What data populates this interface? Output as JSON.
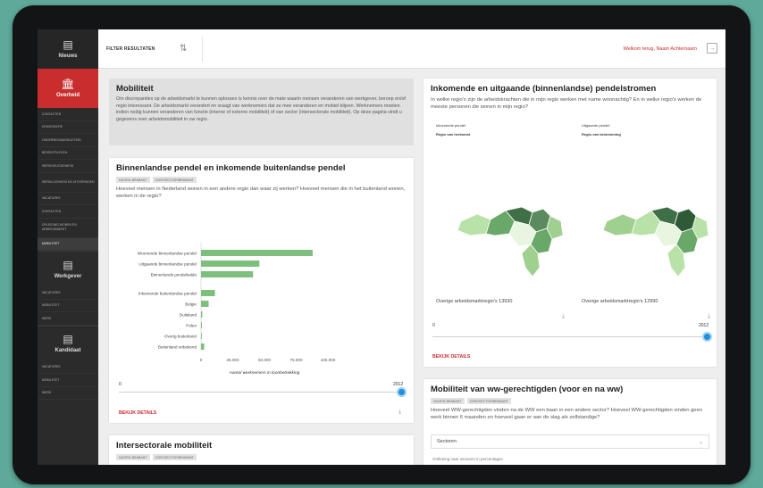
{
  "sidebar": {
    "nieuws": "Nieuws",
    "overheid": "Overheid",
    "overheid_items": [
      "Contacten",
      "Demografie",
      "Onderwijsaansluiting",
      "Bedrijfsleven",
      "Werkgelegenheid",
      "Werkloosheid en uitkeringen",
      "Vacatures",
      "Contacten",
      "Opleiding wonen en arbeidsmarkt",
      "Mobiliteit"
    ],
    "active_item_index": 9,
    "werkgever": "Werkgever",
    "werkgever_items": [
      "Vacatures",
      "Mobiliteit",
      "Werk"
    ],
    "kandidaat": "Kandidaat",
    "kandidaat_items": [
      "Vacatures",
      "Mobiliteit",
      "Werk"
    ]
  },
  "topbar": {
    "filter_label": "FILTER RESULTATEN",
    "welcome": "Welkom terug, Naam Achternaam"
  },
  "mobiliteit": {
    "title": "Mobiliteit",
    "text": "Om discrepanties op de arbeidsmarkt te kunnen oplossen is kennis over de mate waarin mensen veranderen van werkgever, beroep en/of regio interessant. De arbeidsmarkt verandert en vraagt van werknemers dat ze mee veranderen en mobiel blijven. Werknemers moeten indien nodig kunnen veranderen van functie (interne of externe mobiliteit) of van sector (intersectorale mobiliteit). Op deze pagina vindt u gegevens over arbeidsmobiliteit in uw regio."
  },
  "binnenlandse": {
    "title": "Binnenlandse pendel en inkomende buitenlandse pendel",
    "badges": [
      "Noord-Brabant",
      "Zorgsector/Brabant"
    ],
    "text": "Hoeveel mensen in Nederland wonen in een andere regio dan waar zij werken? Hoeveel mensen die in het buitenland wonen, werken in de regio?",
    "slider_min": "0",
    "slider_max": "2012",
    "details": "BEKIJK DETAILS"
  },
  "chart_data": {
    "type": "bar",
    "orientation": "horizontal",
    "categories": [
      "Inkomende binnenlandse pendel",
      "Uitgaande binnenlandse pendel",
      "Binnenlands pendelsaldo",
      "Inkomende buitenlandse pendel",
      "Belgie",
      "Duitsland",
      "Polen",
      "Overig buitenland",
      "Buitenland onbekend"
    ],
    "values": [
      88000,
      46000,
      41000,
      11000,
      6000,
      1000,
      700,
      500,
      2500
    ],
    "xticks": [
      "0",
      "25.000",
      "50.000",
      "75.000",
      "100.000"
    ],
    "xlim": [
      0,
      100000
    ],
    "xlabel": "Aantal werknemers in loonbetrekking",
    "bar_color": "#7dbf7d"
  },
  "pendelstromen": {
    "title": "Inkomende en uitgaande (binnenlandse) pendelstromen",
    "text": "In welke regio's zijn de arbeidskrachten die in mijn regio werken met name woonachtig? En in welke regio's werken de meeste personen die wonen in mijn regio?",
    "left_legend_title": "Inkomende pendel",
    "left_legend_sub": "Regio van herkomst",
    "right_legend_title": "Uitgaande pendel",
    "right_legend_sub": "Regio van bestemming",
    "left_footer": "Overige arbeidsmarktregio's 13930",
    "right_footer": "Overige arbeidsmarktregio's 12990",
    "slider_min": "0",
    "slider_max": "2012",
    "details": "BEKIJK DETAILS"
  },
  "intersectorale": {
    "title": "Intersectorale mobiliteit",
    "badges": [
      "Noord-Brabant",
      "Zorgsector/Brabant"
    ]
  },
  "ww": {
    "title": "Mobiliteit van ww-gerechtigden (voor en na ww)",
    "badges": [
      "Noord-Brabant",
      "Zorgsector/Brabant"
    ],
    "text": "Hoeveel WW-gerechtigden vinden na de WW een baan in een andere sector? Hoeveel WW-gerechtigden vinden geen werk binnen 6 maanden en hoeveel gaan er aan de slag als zelfstandige?",
    "dropdown": "Sectoren",
    "subtext": "Ontlening naar sectoren in percentages"
  },
  "colors": {
    "accent_red": "#c92d2d",
    "sidebar": "#2b2b2b",
    "slider_blue": "#1e90dc",
    "map_dark": "#3f6f47",
    "map_mid": "#6aa86a",
    "map_light": "#b8e2a8"
  }
}
